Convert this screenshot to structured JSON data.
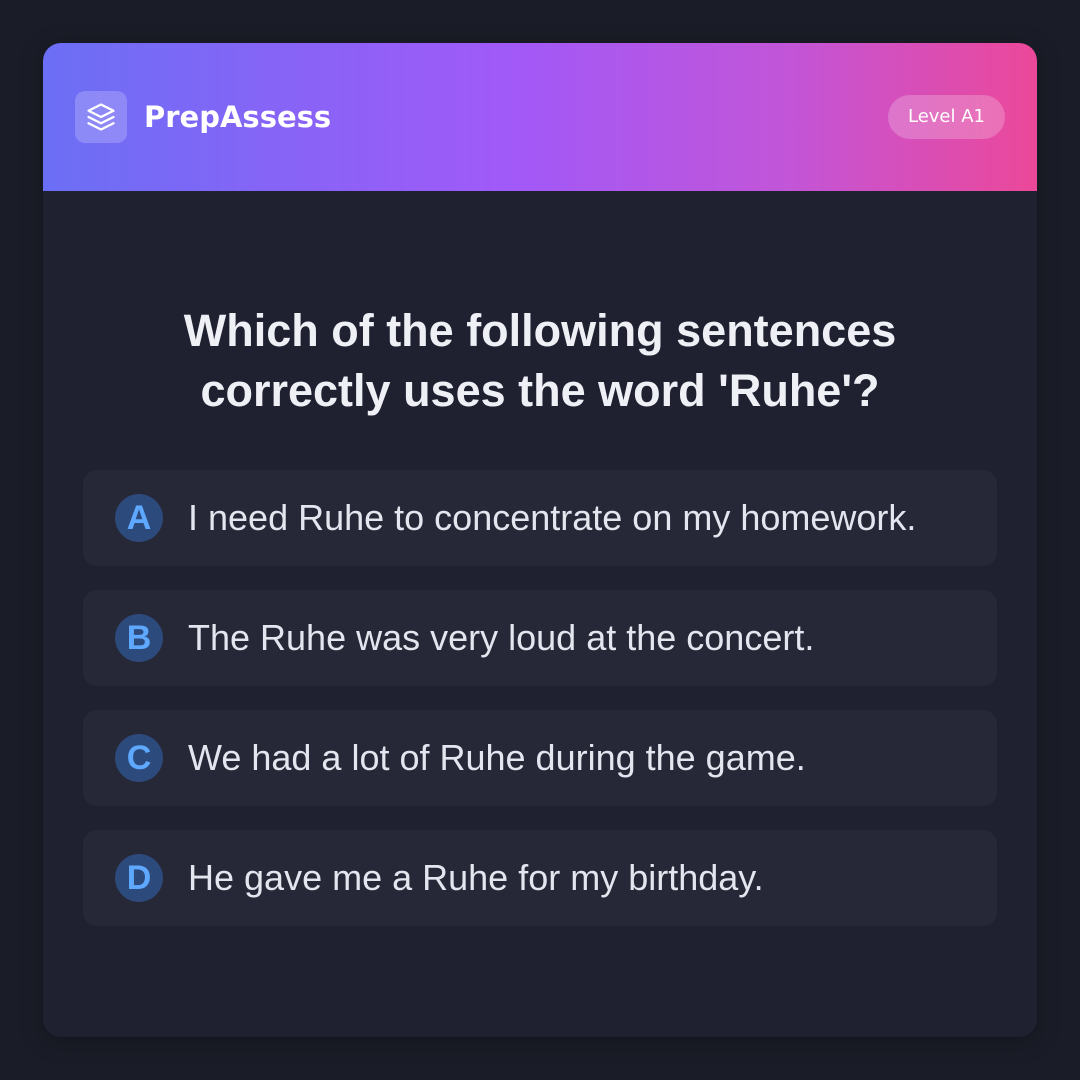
{
  "header": {
    "brand": "PrepAssess",
    "logo_icon": "layers-icon",
    "level": "Level A1",
    "gradient": [
      "#6b6ff5",
      "#a259f7",
      "#ec4899"
    ]
  },
  "question": {
    "text": "Which of the following sentences correctly uses the word 'Ruhe'?"
  },
  "options": [
    {
      "letter": "A",
      "text": "I need Ruhe to concentrate on my homework."
    },
    {
      "letter": "B",
      "text": "The Ruhe was very loud at the concert."
    },
    {
      "letter": "C",
      "text": "We had a lot of Ruhe during the game."
    },
    {
      "letter": "D",
      "text": "He gave me a Ruhe for my birthday."
    }
  ],
  "colors": {
    "background": "#1a1c27",
    "card": "#1f2130",
    "option_bg": "#262837",
    "letter_bg": "#2d4a7c",
    "letter_fg": "#5ea8ff"
  }
}
